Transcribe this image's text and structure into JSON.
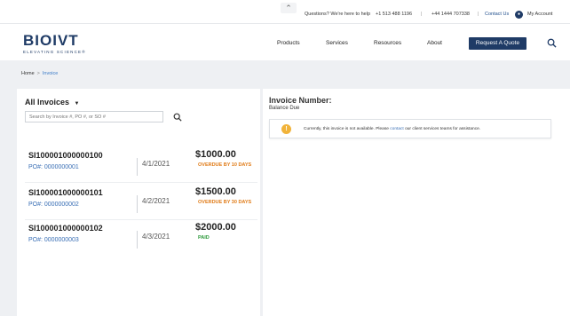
{
  "topbar": {
    "scroll_up_icon": "chevron-up",
    "help_text": "Questions? We're here to help",
    "phone_us": "+1 513 488 1196",
    "separator": "|",
    "phone_intl": "+44 1444 707338",
    "contact_label": "Contact Us",
    "account_label": "My Account"
  },
  "header": {
    "logo_text": "BIOIVT",
    "logo_tagline": "ELEVATING SCIENCE®",
    "nav": [
      "Products",
      "Services",
      "Resources",
      "About"
    ],
    "cta_label": "Request A Quote",
    "search_icon": "search"
  },
  "breadcrumb": {
    "home": "Home",
    "separator": ">",
    "current": "Invoice"
  },
  "invoices": {
    "filter_label": "All Invoices",
    "filter_icon": "caret-down",
    "search_placeholder": "Search by Invoice #, PO #, or SO #",
    "items": [
      {
        "id": "SI100001000000100",
        "po": "PO#: 0000000001",
        "date": "4/1/2021",
        "amount": "$1000.00",
        "status": "OVERDUE BY 10 DAYS",
        "status_color": "#e07b17"
      },
      {
        "id": "SI100001000000101",
        "po": "PO#: 0000000002",
        "date": "4/2/2021",
        "amount": "$1500.00",
        "status": "OVERDUE BY 30 DAYS",
        "status_color": "#e07b17"
      },
      {
        "id": "SI100001000000102",
        "po": "PO#: 0000000003",
        "date": "4/3/2021",
        "amount": "$2000.00",
        "status": "PAID",
        "status_color": "#2e9a3c"
      }
    ]
  },
  "detail": {
    "invoice_number_label": "Invoice Number:",
    "balance_due_label": "Balance Due",
    "alert_icon": "warning",
    "alert_text_before": "Currently, this invoice is not available. Please",
    "alert_link": "contact",
    "alert_text_after": "our client services teams for assistance."
  },
  "colors": {
    "brand_navy": "#1f3b66",
    "link_blue": "#3a6fb5",
    "overdue_orange": "#e07b17",
    "paid_green": "#2e9a3c",
    "alert_yellow": "#f1b33a"
  }
}
